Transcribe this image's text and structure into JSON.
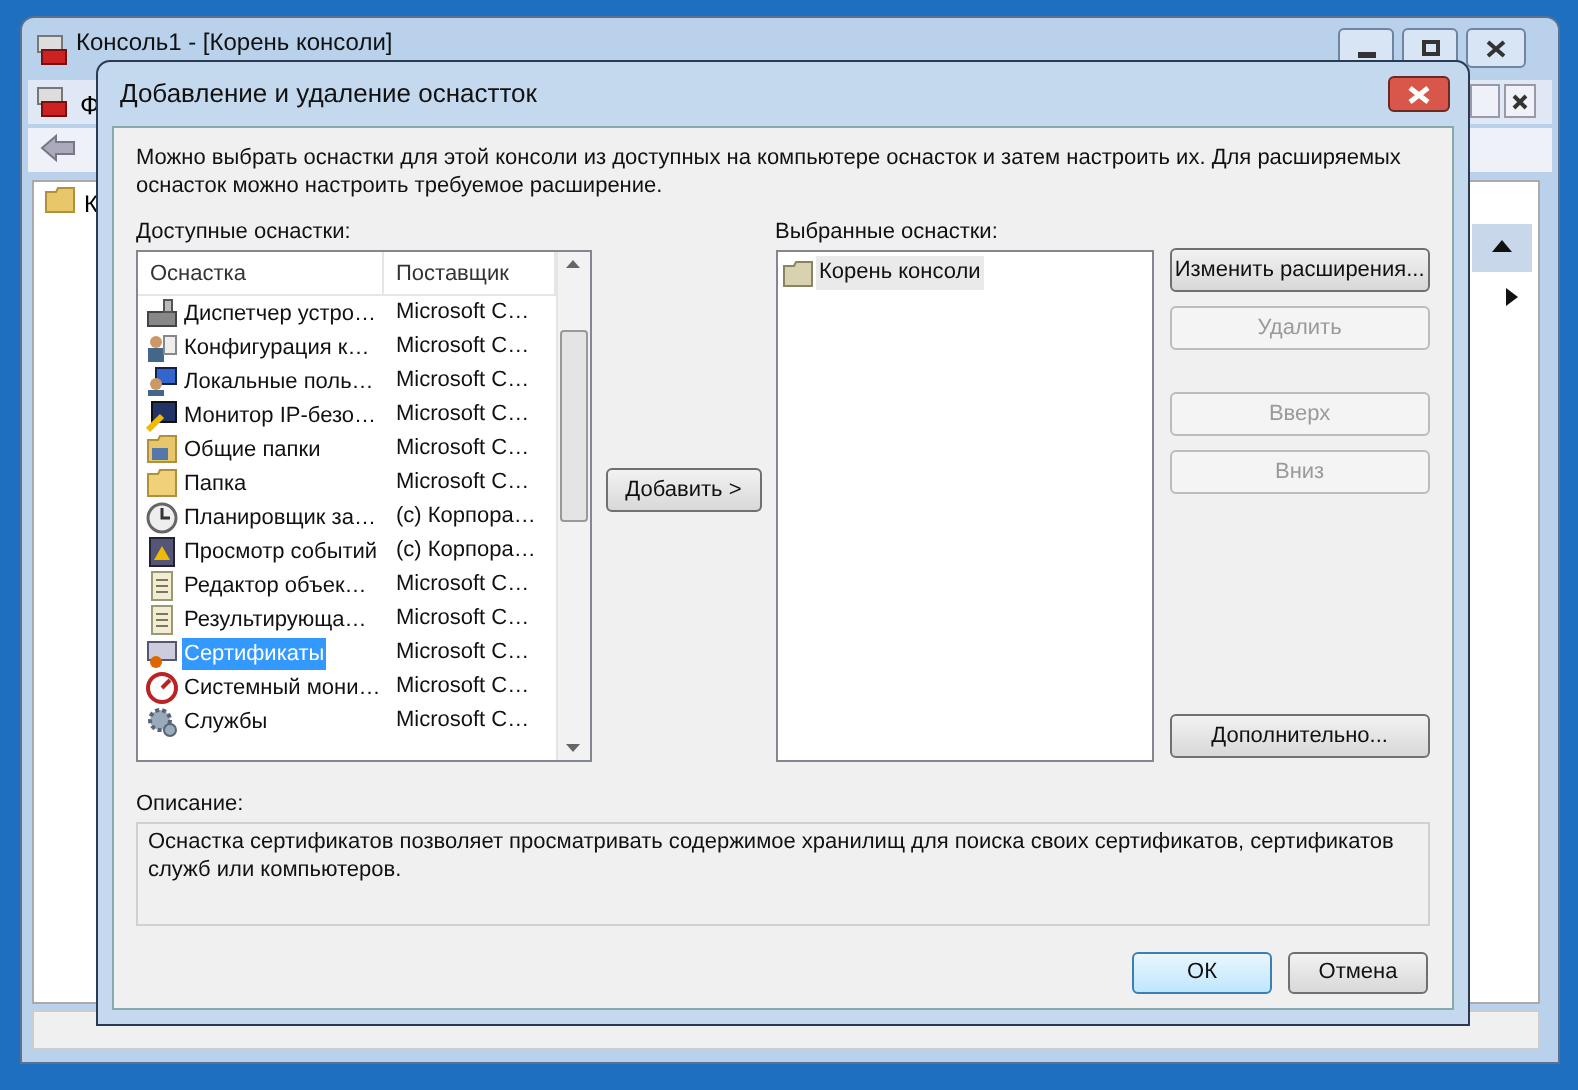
{
  "parent_window": {
    "title": "Консоль1 - [Корень консоли]",
    "menu_fragment": "Ф",
    "tree_fragment": "К"
  },
  "dialog": {
    "title": "Добавление и удаление оснастток",
    "intro": "Можно выбрать оснастки для этой консоли из доступных на компьютере оснасток и затем настроить их. Для расширяемых оснасток можно настроить требуемое расширение.",
    "available_label": "Доступные оснастки:",
    "available": {
      "columns": [
        "Оснастка",
        "Поставщик"
      ],
      "rows": [
        {
          "name": "Диспетчер устро…",
          "vendor": "Microsoft C…",
          "selected": false
        },
        {
          "name": "Конфигурация к…",
          "vendor": "Microsoft C…",
          "selected": false
        },
        {
          "name": "Локальные поль…",
          "vendor": "Microsoft C…",
          "selected": false
        },
        {
          "name": "Монитор IP-безо…",
          "vendor": "Microsoft C…",
          "selected": false
        },
        {
          "name": "Общие папки",
          "vendor": "Microsoft C…",
          "selected": false
        },
        {
          "name": "Папка",
          "vendor": "Microsoft C…",
          "selected": false
        },
        {
          "name": "Планировщик за…",
          "vendor": "(c) Корпора…",
          "selected": false
        },
        {
          "name": "Просмотр событий",
          "vendor": "(c) Корпора…",
          "selected": false
        },
        {
          "name": "Редактор объек…",
          "vendor": "Microsoft C…",
          "selected": false
        },
        {
          "name": "Результирующа…",
          "vendor": "Microsoft C…",
          "selected": false
        },
        {
          "name": "Сертификаты",
          "vendor": "Microsoft C…",
          "selected": true
        },
        {
          "name": "Системный мони…",
          "vendor": "Microsoft C…",
          "selected": false
        },
        {
          "name": "Службы",
          "vendor": "Microsoft C…",
          "selected": false
        }
      ]
    },
    "add_button": {
      "label": "Добавить >"
    },
    "selected_label": "Выбранные оснастки:",
    "selected_items": [
      {
        "label": "Корень консоли",
        "selected": true
      }
    ],
    "side_buttons": [
      {
        "label": "Изменить расширения...",
        "disabled": false
      },
      {
        "label": "Удалить",
        "disabled": true
      },
      {
        "label": "Вверх",
        "disabled": true
      },
      {
        "label": "Вниз",
        "disabled": true
      },
      {
        "label": "Дополнительно...",
        "disabled": false
      }
    ],
    "description_label": "Описание:",
    "description": "Оснастка сертификатов позволяет просматривать содержимое хранилищ для поиска своих сертификатов, сертификатов служб или компьютеров.",
    "buttons": [
      {
        "label": "ОК",
        "default": true
      },
      {
        "label": "Отмена",
        "default": false
      }
    ]
  }
}
